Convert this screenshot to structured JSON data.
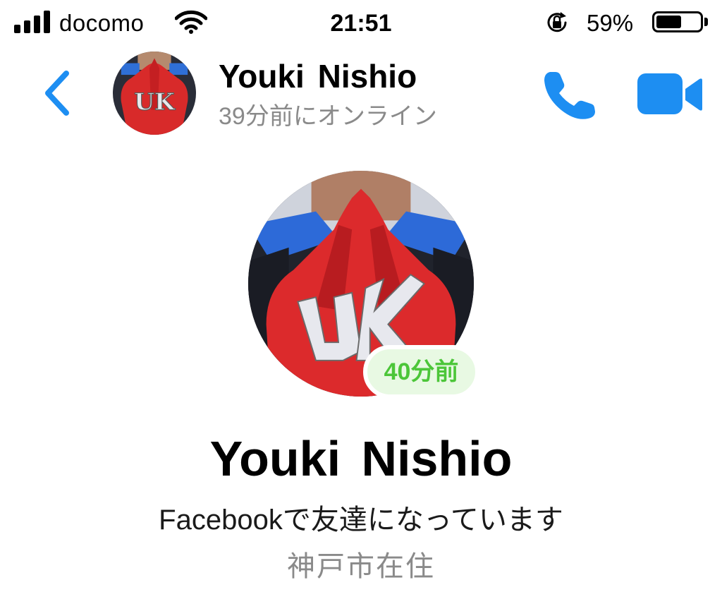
{
  "status_bar": {
    "carrier": "docomo",
    "time": "21:51",
    "battery_percent": "59%",
    "battery_level": 0.59,
    "signal_bars": 4,
    "icons": [
      "signal-icon",
      "wifi-icon",
      "orientation-lock-icon",
      "battery-icon"
    ]
  },
  "header": {
    "back_icon": "chevron-left-icon",
    "name": "Youki  Nishio",
    "status": "39分前にオンライン",
    "call_icon": "phone-icon",
    "video_icon": "video-camera-icon"
  },
  "profile": {
    "name": "Youki  Nishio",
    "last_active_badge": "40分前",
    "friend_status": "Facebookで友達になっています",
    "location": "神戸市在住"
  },
  "colors": {
    "accent_blue": "#1d8ef2",
    "badge_green": "#4cc639",
    "badge_bg": "#e8f9e3",
    "secondary_text": "#8a8a8a"
  }
}
